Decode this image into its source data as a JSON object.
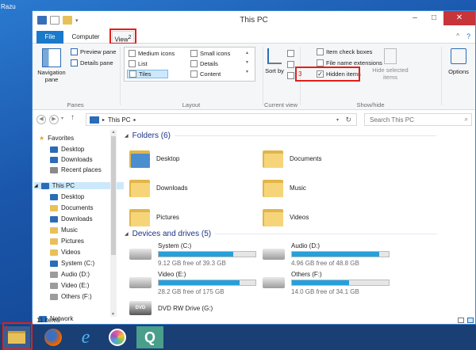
{
  "desktop": {
    "label": "Razu"
  },
  "window": {
    "title": "This PC",
    "min": "–",
    "max": "□",
    "close": "✕"
  },
  "tabs": {
    "file": "File",
    "computer": "Computer",
    "view": "View",
    "view_step": "2"
  },
  "ribbon": {
    "navigation_pane": "Navigation pane",
    "preview_pane": "Preview pane",
    "details_pane": "Details pane",
    "panes_group": "Panes",
    "layout": [
      "Medium icons",
      "Small icons",
      "List",
      "Details",
      "Tiles",
      "Content"
    ],
    "layout_group": "Layout",
    "sort_by": "Sort by",
    "current_view_group": "Current view",
    "item_check_boxes": "Item check boxes",
    "file_name_extensions": "File name extensions",
    "hidden_items": "Hidden items",
    "hidden_step": "3",
    "hide_selected": "Hide selected items",
    "options": "Options",
    "showhide_group": "Show/hide"
  },
  "address": {
    "location": "This PC",
    "search_placeholder": "Search This PC"
  },
  "nav": {
    "favorites": "Favorites",
    "fav_items": [
      "Desktop",
      "Downloads",
      "Recent places"
    ],
    "this_pc": "This PC",
    "pc_items": [
      "Desktop",
      "Documents",
      "Downloads",
      "Music",
      "Pictures",
      "Videos",
      "System (C:)",
      "Audio (D:)",
      "Video (E:)",
      "Others (F:)"
    ],
    "network": "Network"
  },
  "folders_header": "Folders (6)",
  "folders": [
    "Desktop",
    "Documents",
    "Downloads",
    "Music",
    "Pictures",
    "Videos"
  ],
  "devices_header": "Devices and drives (5)",
  "drives": [
    {
      "name": "System (C:)",
      "free": "9.12 GB free of 39.3 GB",
      "used": 0.77
    },
    {
      "name": "Audio (D:)",
      "free": "4.96 GB free of 48.8 GB",
      "used": 0.9
    },
    {
      "name": "Video (E:)",
      "free": "28.2 GB free of 175 GB",
      "used": 0.84
    },
    {
      "name": "Others (F:)",
      "free": "14.0 GB free of 34.1 GB",
      "used": 0.59
    }
  ],
  "dvd": {
    "name": "DVD RW Drive (G:)",
    "label": "DVD"
  },
  "status": "11 items",
  "taskbar": {
    "q_label": "Q",
    "step": "1"
  },
  "colors": {
    "accent": "#1979ca",
    "highlight": "#e0201b",
    "drive_bar": "#26a0da"
  }
}
